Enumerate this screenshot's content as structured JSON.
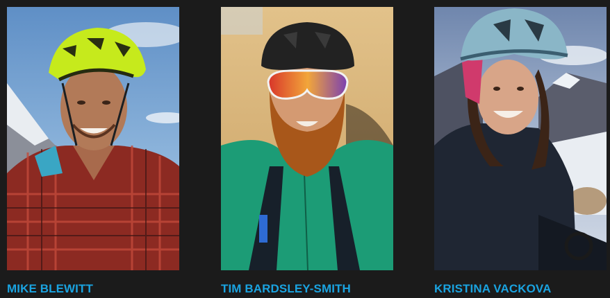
{
  "team": {
    "members": [
      {
        "name": "MIKE BLEWITT",
        "photo_icon": "rider-portrait-helmet-lime",
        "colors": {
          "sky": "#6f9fd0",
          "helmet": "#c6ea1c",
          "shirt": "#8c2a22",
          "skin": "#b27a58"
        }
      },
      {
        "name": "TIM BARDSLEY-SMITH",
        "photo_icon": "rider-portrait-helmet-black",
        "colors": {
          "sand": "#d9b475",
          "helmet": "#222222",
          "shirt": "#1c9c76",
          "beard": "#a8571a",
          "skin": "#d49a72"
        }
      },
      {
        "name": "KRISTINA VACKOVA",
        "photo_icon": "rider-portrait-helmet-teal",
        "colors": {
          "sky": "#8fa3c4",
          "helmet": "#8ab6c7",
          "jacket": "#1f2633",
          "snow": "#e9edf2",
          "skin": "#d8a588"
        }
      }
    ],
    "name_color": "#1aa3e0"
  }
}
